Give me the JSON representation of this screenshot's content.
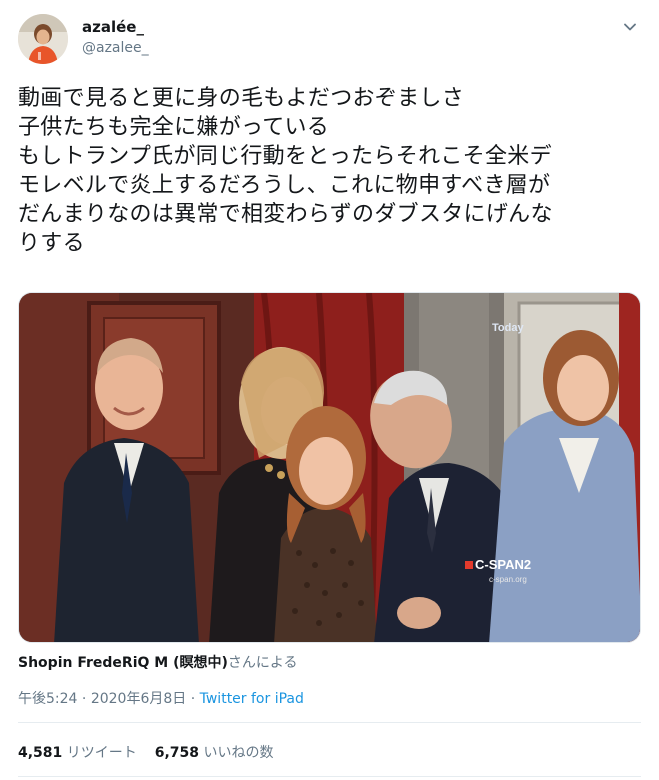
{
  "user": {
    "display_name": "azalée_",
    "handle": "@azalee_"
  },
  "tweet": {
    "lines": [
      "動画で見ると更に身の毛もよだつおぞましさ",
      "子供たちも完全に嫌がっている",
      "もしトランプ氏が同じ行動をとったらそれこそ全米デ",
      "モレベルで炎上するだろうし、これに物申すべき層が",
      "だんまりなのは異常で相変わらずのダブスタにげんな",
      "りする"
    ]
  },
  "media": {
    "overlay_today": "Today",
    "overlay_network": "C-SPAN2",
    "overlay_url": "c-span.org"
  },
  "attribution": {
    "name": "Shopin FredeRiQ M (瞑想中)",
    "suffix": "さんによる"
  },
  "meta": {
    "time": "午後5:24",
    "sep1": " · ",
    "date": "2020年6月8日",
    "sep2": " · ",
    "source": "Twitter for iPad"
  },
  "stats": {
    "retweets_count": "4,581",
    "retweets_label": "リツイート",
    "likes_count": "6,758",
    "likes_label": "いいねの数"
  },
  "colors": {
    "link": "#1b95e0",
    "muted": "#657786",
    "text": "#14171a"
  }
}
